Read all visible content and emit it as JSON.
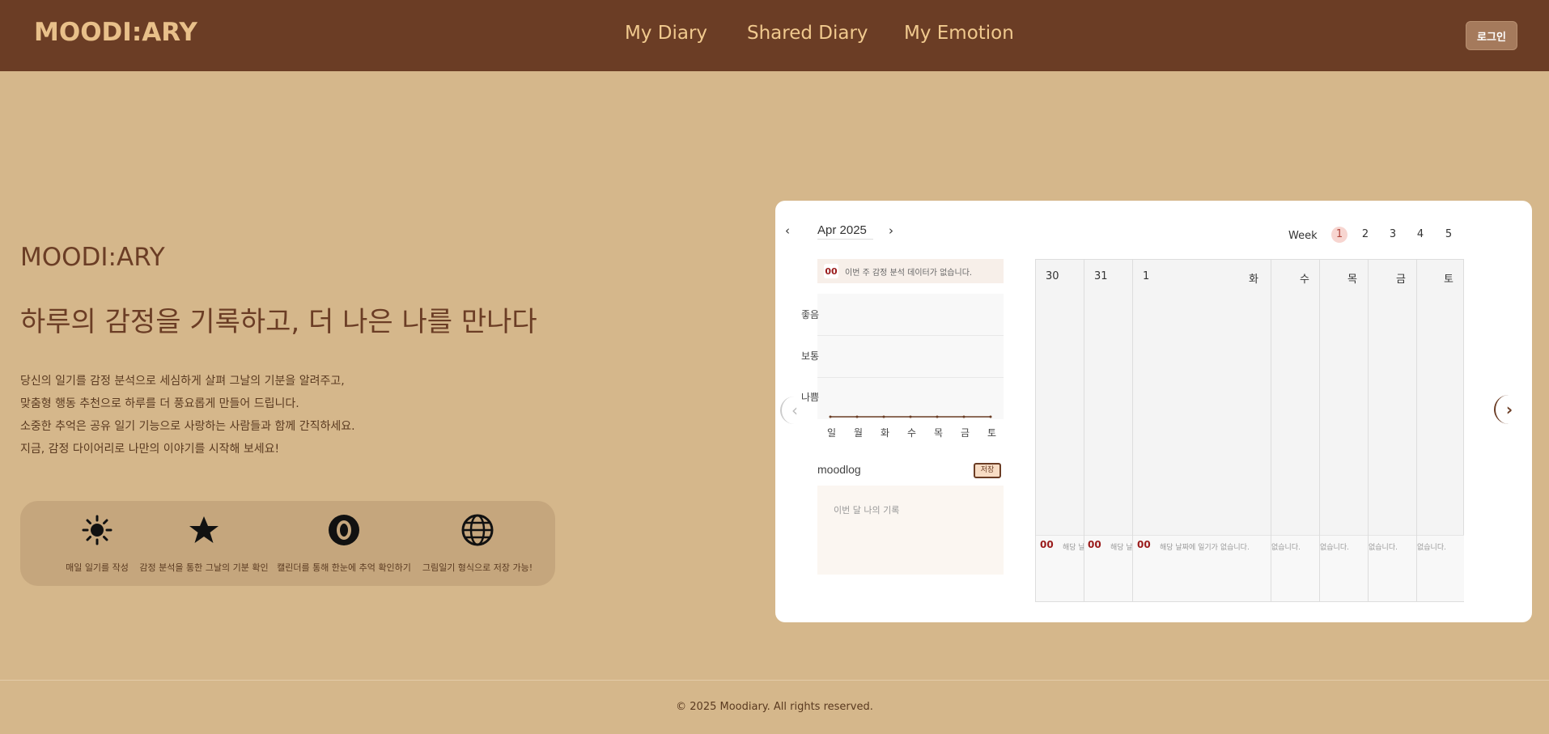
{
  "header": {
    "logo": "MOODI:ARY",
    "nav": [
      "My Diary",
      "Shared Diary",
      "My Emotion"
    ],
    "login_label": "로그인"
  },
  "hero": {
    "brand": "MOODI:ARY",
    "title": "하루의 감정을 기록하고, 더 나은 나를 만나다",
    "desc": [
      "당신의 일기를 감정 분석으로 세심하게 살펴 그날의 기분을 알려주고,",
      "맞춤형 행동 추천으로 하루를 더 풍요롭게 만들어 드립니다.",
      "소중한 추억은 공유 일기 기능으로 사랑하는 사람들과 함께 간직하세요.",
      "지금, 감정 다이어리로 나만의 이야기를 시작해 보세요!"
    ],
    "features": [
      {
        "icon": "sun-icon",
        "label": "매일 일기를 작성"
      },
      {
        "icon": "star-icon",
        "label": "감정 분석을 통한 그날의 기분 확인"
      },
      {
        "icon": "eye-icon",
        "label": "캘린더를 통해 한눈에 추억 확인하기"
      },
      {
        "icon": "globe-icon",
        "label": "그림일기 형식으로 저장 가능!"
      }
    ]
  },
  "calendar_card": {
    "month": "Apr 2025",
    "prev": "‹",
    "next": "›",
    "week_label": "Week",
    "weeks": [
      "1",
      "2",
      "3",
      "4",
      "5"
    ],
    "active_week": "1",
    "emotion_badge": "00",
    "emotion_banner": "이번 주 감정 분석 데이터가 없습니다.",
    "chart_y_labels": [
      "좋음",
      "보통",
      "나쁨"
    ],
    "chart_x_labels": [
      "일",
      "월",
      "화",
      "수",
      "목",
      "금",
      "토"
    ],
    "moodlog_title": "moodlog",
    "save_label": "저장",
    "moodlog_placeholder": "이번 달 나의 기록",
    "slide_prev": "‹",
    "slide_next": "›",
    "days": [
      {
        "date": "30",
        "emo": "00",
        "note": "해당 날짜에 일기가 없습니다."
      },
      {
        "date": "31",
        "emo": "00",
        "note": "해당 날짜에 일기가 없습니다."
      },
      {
        "date": "1",
        "label": "화",
        "emo": "00",
        "note": "해당 날짜에 일기가 없습니다."
      },
      {
        "date": "수",
        "note": "없습니다."
      },
      {
        "date": "목",
        "note": "없습니다."
      },
      {
        "date": "금",
        "note": "없습니다."
      },
      {
        "date": "토",
        "note": "없습니다."
      }
    ]
  },
  "footer": {
    "copyright": "© 2025 Moodiary. All rights reserved."
  }
}
